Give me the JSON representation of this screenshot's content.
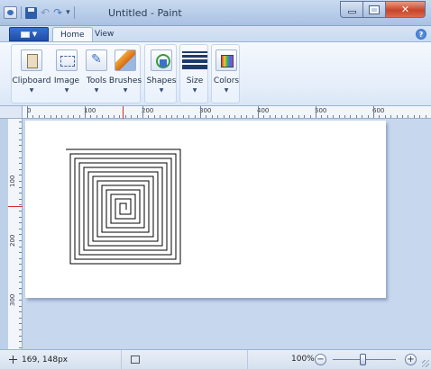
{
  "window": {
    "title": "Untitled - Paint"
  },
  "quick_access": {
    "items": [
      "app-icon",
      "save-icon",
      "undo-icon",
      "redo-icon",
      "customize-icon"
    ]
  },
  "tabs": {
    "items": [
      {
        "label": "Home",
        "active": true
      },
      {
        "label": "View",
        "active": false
      }
    ]
  },
  "ribbon": {
    "groups": [
      {
        "label": "Clipboard",
        "icon": "clipboard-icon"
      },
      {
        "label": "Image",
        "icon": "image-icon"
      },
      {
        "label": "Tools",
        "icon": "tools-icon"
      },
      {
        "label": "Brushes",
        "icon": "brushes-icon"
      },
      {
        "label": "Shapes",
        "icon": "shapes-icon"
      },
      {
        "label": "Size",
        "icon": "size-icon"
      },
      {
        "label": "Colors",
        "icon": "colors-icon"
      }
    ]
  },
  "ruler": {
    "horizontal_labels": [
      "0",
      "100",
      "200",
      "300",
      "400",
      "500",
      "600"
    ],
    "vertical_labels": [
      "100",
      "200",
      "300"
    ]
  },
  "canvas": {
    "drawing": "square-spiral",
    "stroke_color": "#000000"
  },
  "status": {
    "cursor_position": "169, 148px",
    "zoom": "100%"
  },
  "colors": {
    "accent": "#1e4ea8",
    "close_button": "#c8452a"
  }
}
